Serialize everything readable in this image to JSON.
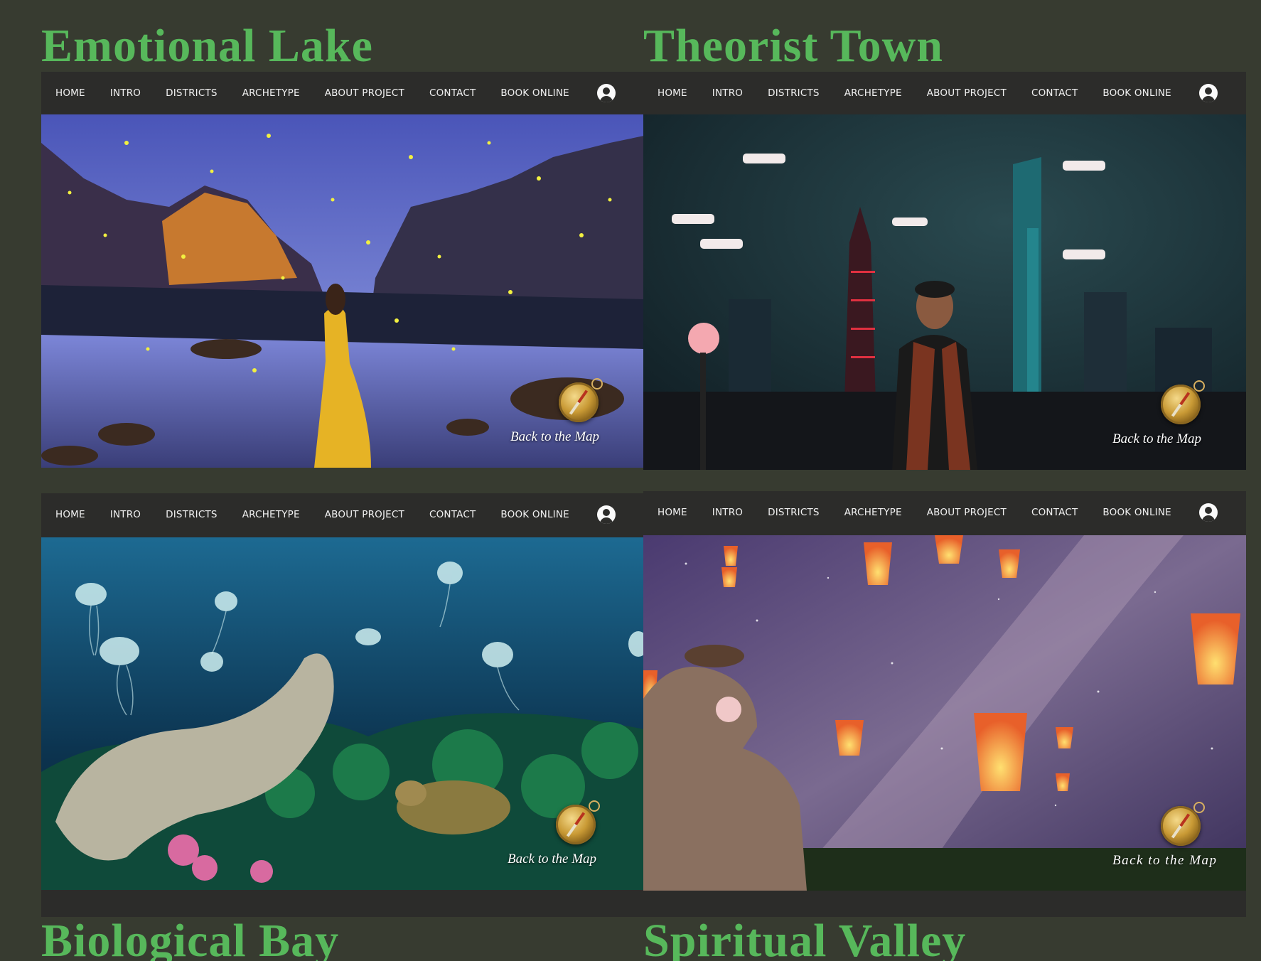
{
  "titles": {
    "emotional": "Emotional Lake",
    "theorist": "Theorist Town",
    "biological": "Biological Bay",
    "spiritual": "Spiritual Valley"
  },
  "nav": {
    "items": [
      "HOME",
      "INTRO",
      "DISTRICTS",
      "ARCHETYPE",
      "ABOUT PROJECT",
      "CONTACT",
      "BOOK ONLINE"
    ],
    "account_icon": "user-account-icon"
  },
  "back_link": {
    "label": "Back to the Map",
    "icon": "compass-icon"
  },
  "colors": {
    "background": "#373b30",
    "title_green": "#57b85b",
    "nav_bg": "#2c2c2a"
  }
}
